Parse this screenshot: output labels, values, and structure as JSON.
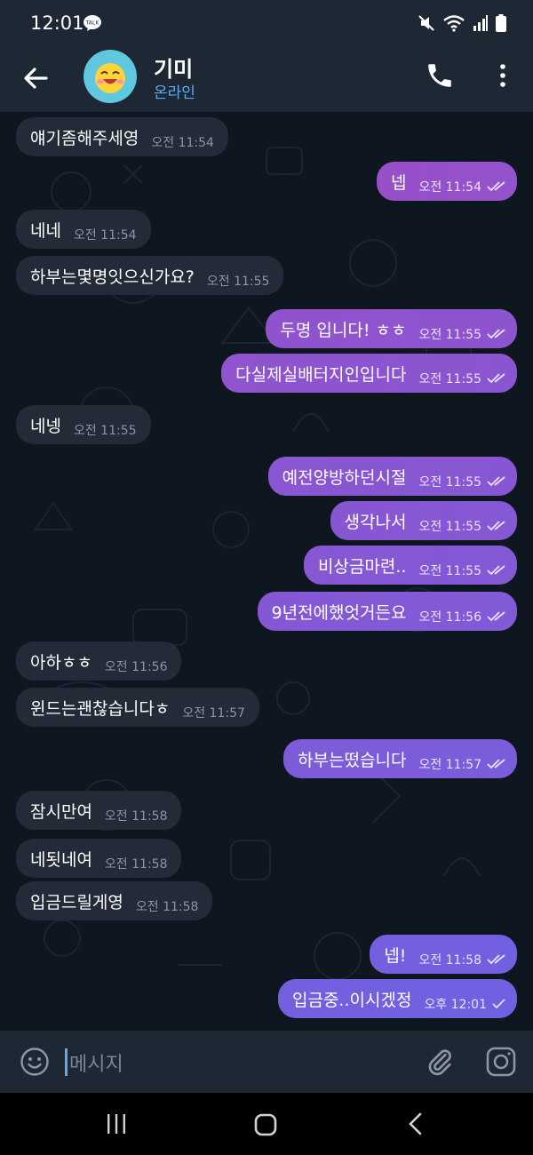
{
  "status_bar": {
    "time": "12:01",
    "talk_badge": "TALK"
  },
  "header": {
    "name": "기미",
    "status": "온라인"
  },
  "messages": [
    {
      "dir": "in",
      "text": "얘기좀해주세영",
      "time": "오전 11:54"
    },
    {
      "dir": "out",
      "text": "넵",
      "time": "오전 11:54"
    },
    {
      "dir": "in",
      "text": "네네",
      "time": "오전 11:54"
    },
    {
      "dir": "in",
      "text": "하부는몇명잇으신가요?",
      "time": "오전 11:55"
    },
    {
      "dir": "out",
      "text": "두명 입니다! ㅎㅎ",
      "time": "오전 11:55"
    },
    {
      "dir": "out",
      "text": "다실제실배터지인입니다",
      "time": "오전 11:55"
    },
    {
      "dir": "in",
      "text": "네넹",
      "time": "오전 11:55"
    },
    {
      "dir": "out",
      "text": "예전양방하던시절",
      "time": "오전 11:55"
    },
    {
      "dir": "out",
      "text": "생각나서",
      "time": "오전 11:55"
    },
    {
      "dir": "out",
      "text": "비상금마련..",
      "time": "오전 11:55"
    },
    {
      "dir": "out",
      "text": "9년전에했엇거든요",
      "time": "오전 11:56"
    },
    {
      "dir": "in",
      "text": "아하ㅎㅎ",
      "time": "오전 11:56"
    },
    {
      "dir": "in",
      "text": "윈드는괜찮습니다ㅎ",
      "time": "오전 11:57"
    },
    {
      "dir": "out",
      "text": "하부는떴습니다",
      "time": "오전 11:57"
    },
    {
      "dir": "in",
      "text": "잠시만여",
      "time": "오전 11:58"
    },
    {
      "dir": "in",
      "text": "네됫네여",
      "time": "오전 11:58"
    },
    {
      "dir": "in",
      "text": "입금드릴게영",
      "time": "오전 11:58"
    },
    {
      "dir": "out",
      "text": "넵!",
      "time": "오전 11:58"
    },
    {
      "dir": "out",
      "text": "입금중..이시겠정",
      "time": "오후 12:01",
      "single_check": true
    }
  ],
  "composer": {
    "placeholder": "메시지"
  },
  "colors": {
    "outgoing_top": "#9a4fc8",
    "outgoing_bottom": "#6b63e4",
    "incoming": "#222b37",
    "accent": "#5fa9e8"
  }
}
